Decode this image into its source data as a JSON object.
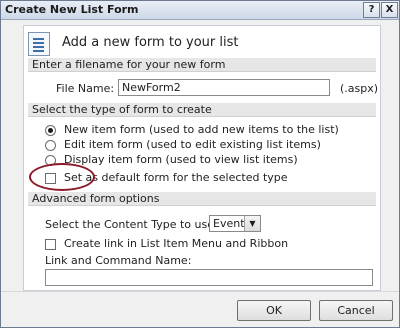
{
  "window": {
    "title": "Create New List Form",
    "help_glyph": "?",
    "close_glyph": "X"
  },
  "header": {
    "title": "Add a new form to your list",
    "icon": "form-list-icon"
  },
  "filename_section": {
    "heading": "Enter a filename for your new form",
    "file_name_label": "File Name:",
    "file_name_value": "NewForm2",
    "extension": "(.aspx)"
  },
  "type_section": {
    "heading": "Select the type of form to create",
    "options": [
      {
        "label": "New item form (used to add new items to the list)",
        "selected": true
      },
      {
        "label": "Edit item form (used to edit existing list items)",
        "selected": false
      },
      {
        "label": "Display item form (used to view list items)",
        "selected": false
      }
    ],
    "default_checkbox_label": "Set as default form for the selected type",
    "default_checked": false
  },
  "advanced_section": {
    "heading": "Advanced form options",
    "content_type_label": "Select the Content Type to use:",
    "content_type_value": "Event",
    "create_link_label": "Create link in List Item Menu and Ribbon",
    "create_link_checked": false,
    "link_command_label": "Link and Command Name:",
    "link_command_value": ""
  },
  "buttons": {
    "ok": "OK",
    "cancel": "Cancel"
  },
  "colors": {
    "annotation_circle": "#8b1a2a",
    "section_header_bg": "#e6e6e6",
    "titlebar": "#cdd8e8"
  }
}
